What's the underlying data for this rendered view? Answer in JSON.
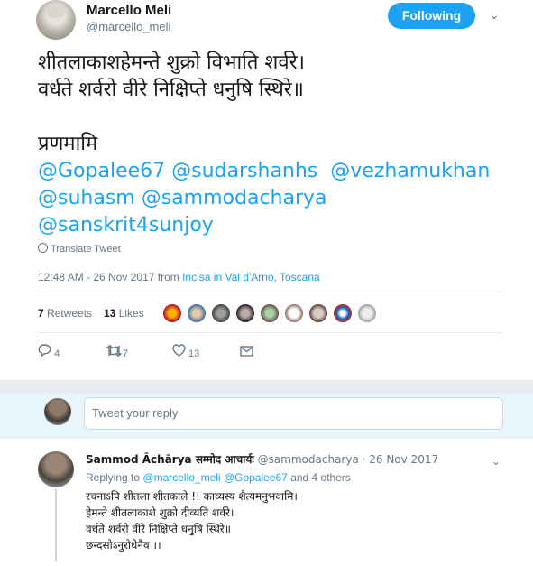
{
  "author": {
    "display_name": "Marcello Meli",
    "username": "@marcello_meli",
    "follow_label": "Following"
  },
  "tweet": {
    "line1": "शीतलाकाशहेमन्ते शुक्रो विभाति शर्वरे।",
    "line2": "वर्धते शर्वरो वीरे निक्षिप्ते धनुषि स्थिरे॥",
    "line3": "प्रणमामि",
    "mentions_row1": [
      "@Gopalee67",
      "@sudarshanhs",
      "@vezhamukhan"
    ],
    "mentions_row2": [
      "@suhasm",
      "@sammodacharya"
    ],
    "mentions_row3": [
      "@sanskrit4sunjoy"
    ],
    "translate_label": "Translate Tweet",
    "timestamp": "12:48 AM - 26 Nov 2017 from ",
    "location": "Incisa in Val d'Arno, Toscana"
  },
  "stats": {
    "retweets_count": "7",
    "retweets_label": "Retweets",
    "likes_count": "13",
    "likes_label": "Likes"
  },
  "actions": {
    "reply_count": "4",
    "retweet_count": "7",
    "like_count": "13"
  },
  "compose": {
    "placeholder": "Tweet your reply"
  },
  "reply": {
    "display_name": "Sammod Āchārya सम्मोद आचार्यः",
    "username_date": "@sammodacharya · 26 Nov 2017",
    "replying_to_label": "Replying to",
    "replying_to_m1": "@marcello_meli",
    "replying_to_m2": "@Gopalee67",
    "replying_to_rest": "and 4 others",
    "line1": "रचनाऽपि शीतला शीतकाले !! काव्यस्य शैत्यमनुभवामि।",
    "line2": "हेमन्ते शीतलाकाशे शुक्रो दीव्यति शर्वरे।",
    "line3": "वर्धते शर्वरो वीरे निक्षिप्ते धनुषि स्थिरे॥",
    "line4": " छन्दसोऽनुरोधेनैव ।।"
  },
  "colors": {
    "accent": "#1da1f2",
    "muted": "#657786",
    "text": "#14171a"
  }
}
